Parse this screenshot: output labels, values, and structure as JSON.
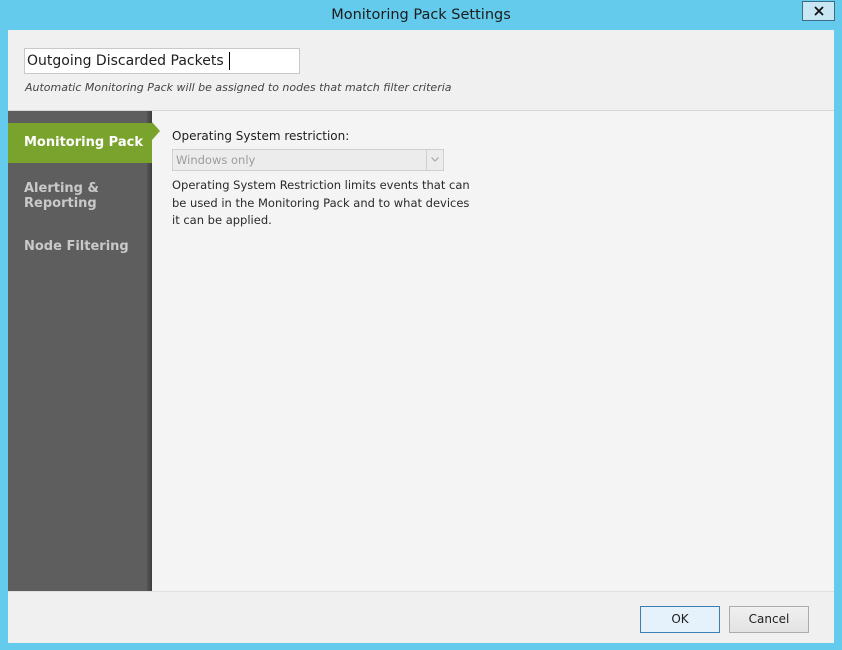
{
  "window": {
    "title": "Monitoring Pack Settings",
    "close_icon": "close-icon",
    "accent_color": "#64cbec"
  },
  "header": {
    "pack_name_value": "Outgoing Discarded Packets",
    "subtitle": "Automatic Monitoring Pack will be assigned to nodes that match filter criteria"
  },
  "sidebar": {
    "active_color": "#7aa32e",
    "items": [
      {
        "label": "Monitoring Pack",
        "active": true
      },
      {
        "label_line1": "Alerting &",
        "label_line2": "Reporting",
        "active": false
      },
      {
        "label": "Node Filtering",
        "active": false
      }
    ]
  },
  "main": {
    "os_label": "Operating System restriction:",
    "os_selected": "Windows only",
    "os_dropdown_icon": "chevron-down-icon",
    "os_description": "Operating System Restriction limits events that can be used in the Monitoring Pack and to what devices it can be applied."
  },
  "footer": {
    "ok_label": "OK",
    "cancel_label": "Cancel"
  }
}
